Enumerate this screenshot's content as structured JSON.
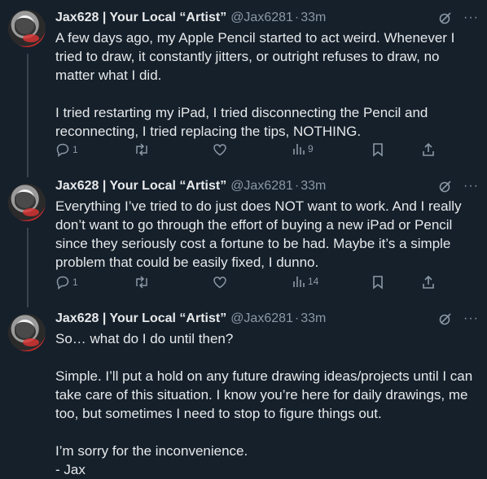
{
  "tweets": [
    {
      "name": "Jax628 | Your Local “Artist”",
      "handle": "@Jax6281",
      "time": "33m",
      "text": "A few days ago, my Apple Pencil started to act weird. Whenever I tried to draw, it constantly jitters, or outright refuses to draw, no matter what I did.\n\nI tried restarting my iPad, I tried disconnecting the Pencil and reconnecting, I tried replacing the tips, NOTHING.",
      "replies": "1",
      "views": "9"
    },
    {
      "name": "Jax628 | Your Local “Artist”",
      "handle": "@Jax6281",
      "time": "33m",
      "text": "Everything I’ve tried to do just does NOT want to work. And I really don’t want to go through the effort of buying a new iPad or Pencil since they seriously cost a fortune to be had.  Maybe it’s a simple problem that could be easily fixed, I dunno.",
      "replies": "1",
      "views": "14"
    },
    {
      "name": "Jax628 | Your Local “Artist”",
      "handle": "@Jax6281",
      "time": "33m",
      "text": "So… what do I do until then?\n\nSimple. I’ll put a hold on any future drawing ideas/projects until I can take care of this situation. I know you’re here for daily drawings, me too, but sometimes I need to stop to figure things out.\n\nI’m sorry for the inconvenience.\n- Jax"
    }
  ],
  "separator": "·",
  "more_label": "···",
  "icons": [
    "grok-icon",
    "more-icon",
    "reply-icon",
    "retweet-icon",
    "like-icon",
    "views-icon",
    "bookmark-icon",
    "share-icon"
  ],
  "colors": {
    "background": "#15202b",
    "text": "#e7e9ea",
    "muted": "#8b98a5",
    "thread_line": "#38444d"
  }
}
